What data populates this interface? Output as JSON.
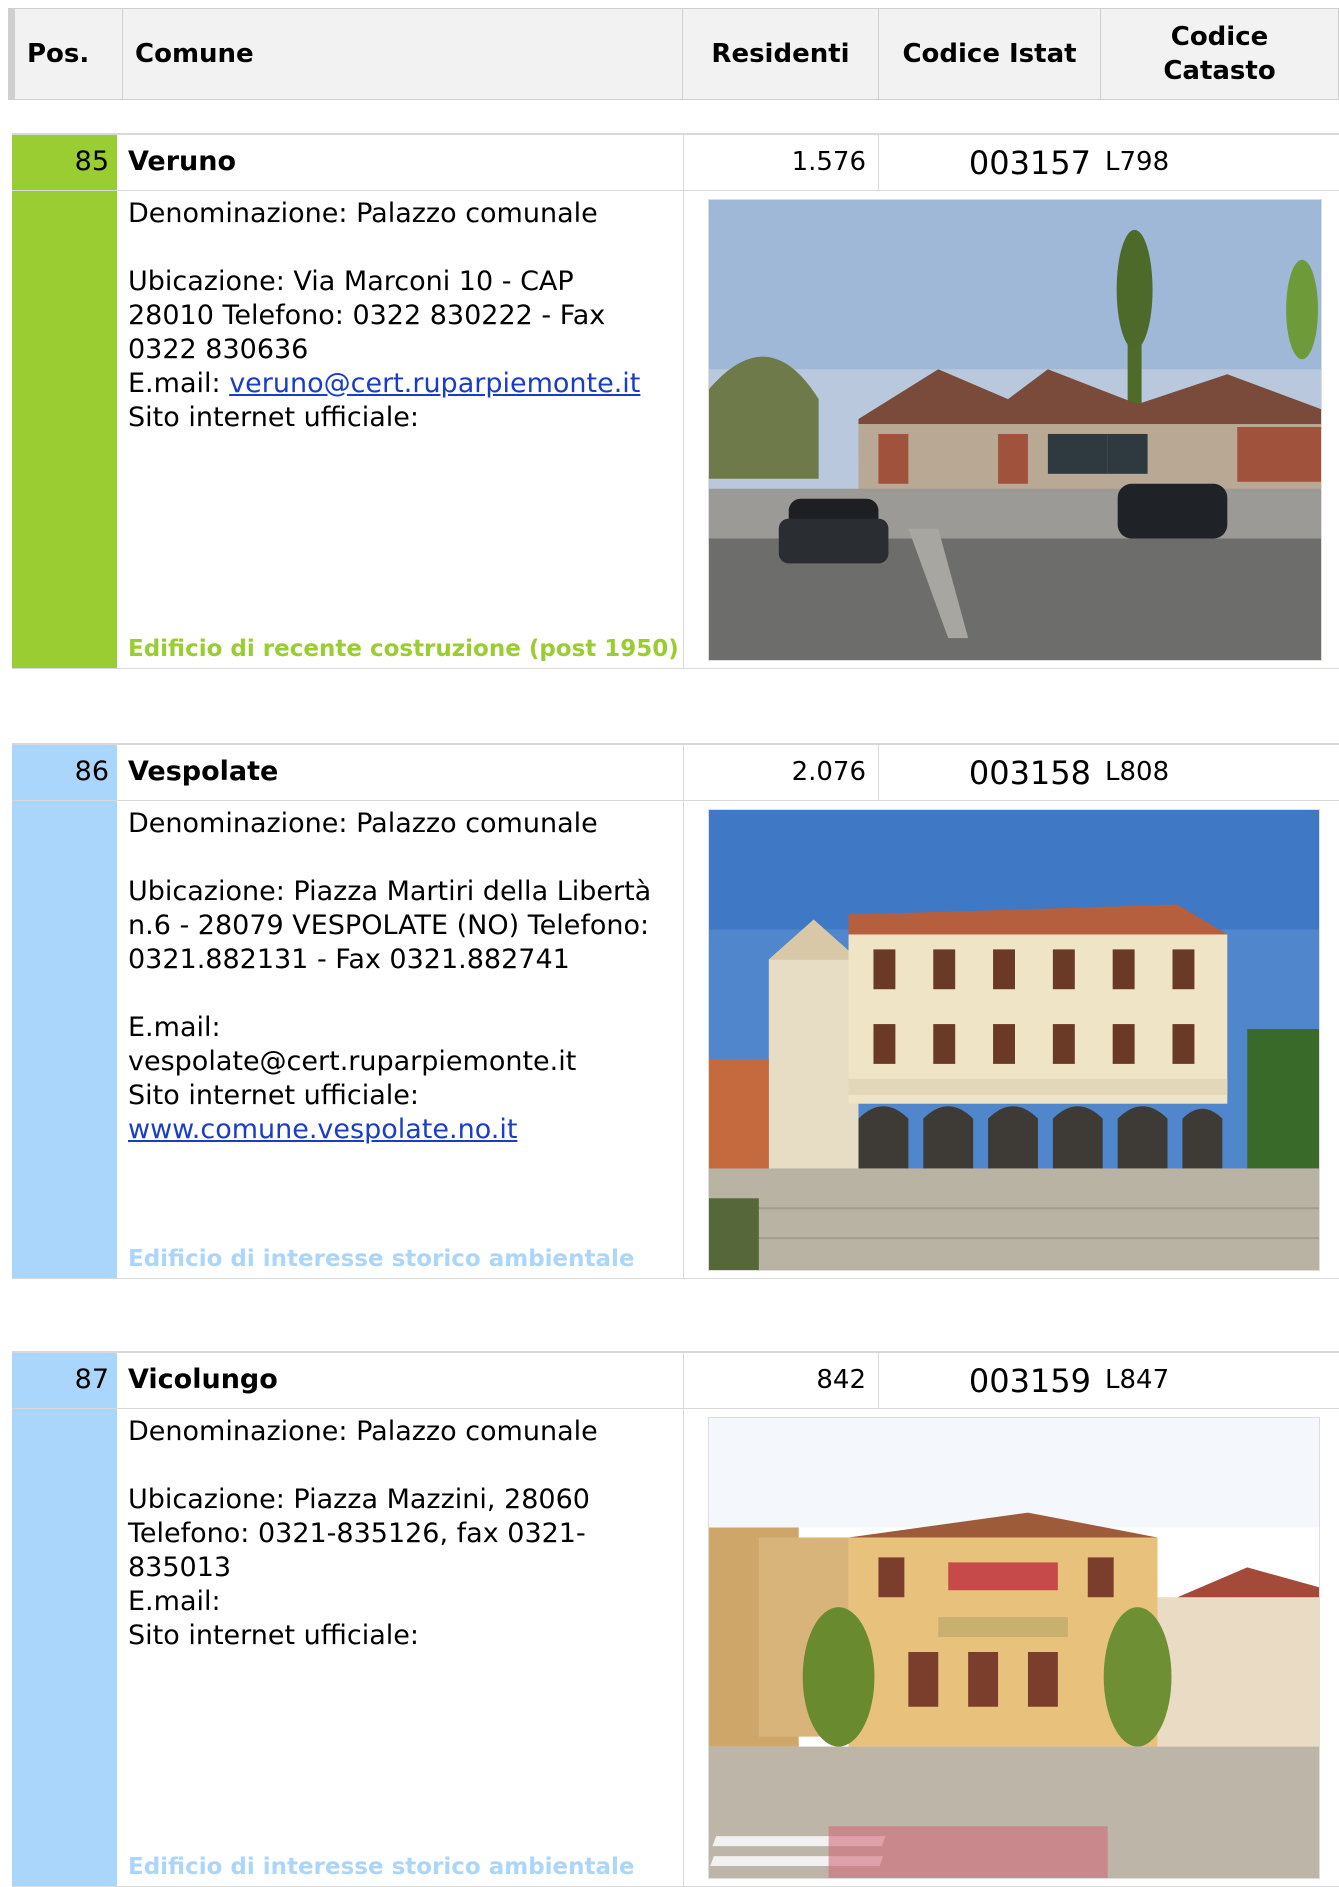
{
  "header": {
    "pos": "Pos.",
    "comune": "Comune",
    "residenti": "Residenti",
    "istat": "Codice Istat",
    "catasto": "Codice\nCatasto"
  },
  "entries": [
    {
      "pos": "85",
      "name": "Veruno",
      "residenti": "1.576",
      "istat": "003157",
      "catasto": "L798",
      "denominazione": "Denominazione: Palazzo comunale",
      "ubicazione": "Ubicazione: Via Marconi 10 - CAP 28010 Telefono: 0322 830222 - Fax 0322 830636",
      "email_label": "E.mail:",
      "email_value": "veruno@cert.ruparpiemonte.it",
      "sito_label": "Sito internet ufficiale:",
      "sito_value": "",
      "note": "Edificio di recente costruzione (post 1950)",
      "color": "#9acd32",
      "photo_icon": "modern-town-hall-photo"
    },
    {
      "pos": "86",
      "name": "Vespolate",
      "residenti": "2.076",
      "istat": "003158",
      "catasto": "L808",
      "denominazione": "Denominazione: Palazzo comunale",
      "ubicazione": "Ubicazione: Piazza Martiri della Libertà n.6 - 28079 VESPOLATE (NO) Telefono: 0321.882131 - Fax 0321.882741",
      "email_label": "E.mail:",
      "email_value": "vespolate@cert.ruparpiemonte.it",
      "sito_label": "Sito internet ufficiale:",
      "sito_value": "www.comune.vespolate.no.it",
      "note": "Edificio di interesse storico ambientale",
      "color": "#abd6fb",
      "photo_icon": "historic-town-hall-photo"
    },
    {
      "pos": "87",
      "name": "Vicolungo",
      "residenti": "842",
      "istat": "003159",
      "catasto": "L847",
      "denominazione": "Denominazione: Palazzo comunale",
      "ubicazione": "Ubicazione: Piazza Mazzini, 28060 Telefono: 0321-835126, fax 0321-835013",
      "email_label": "E.mail:",
      "email_value": "",
      "sito_label": "Sito internet ufficiale:",
      "sito_value": "",
      "note": "Edificio di interesse storico ambientale",
      "color": "#abd6fb",
      "photo_icon": "municipio-building-photo"
    }
  ]
}
